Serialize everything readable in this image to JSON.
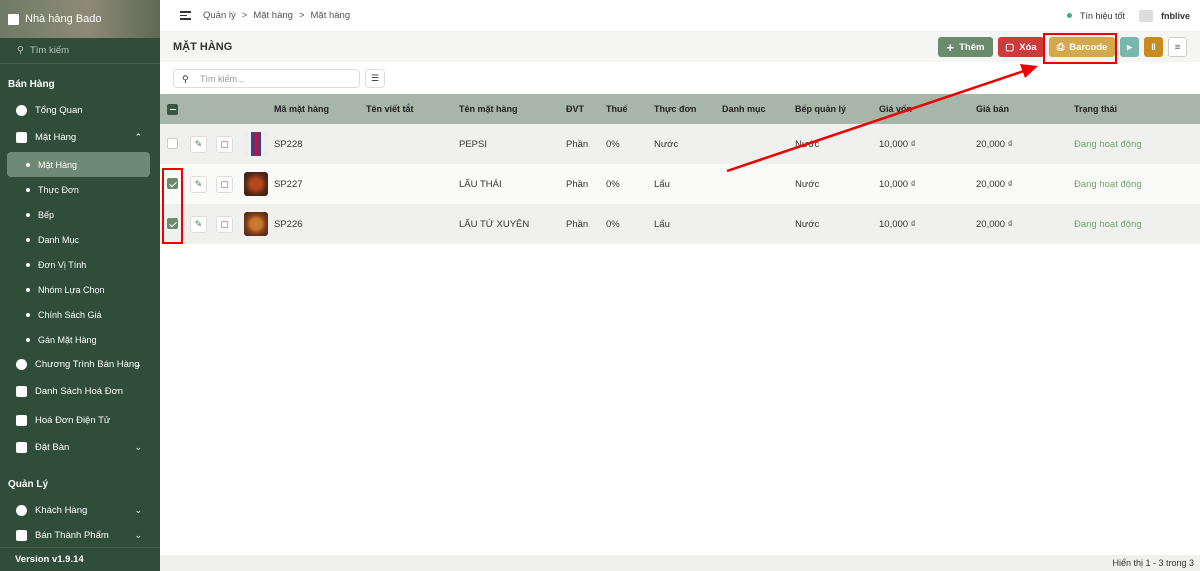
{
  "sidebar": {
    "brand": "Nhà hàng Bado",
    "search_placeholder": "Tìm kiếm",
    "section_sales": "Bán Hàng",
    "overview": "Tổng Quan",
    "items_group": "Mặt Hàng",
    "sub_items": [
      "Mặt Hàng",
      "Thực Đơn",
      "Bếp",
      "Danh Mục",
      "Đơn Vị Tính",
      "Nhóm Lựa Chọn",
      "Chính Sách Giá",
      "Gán Mặt Hàng"
    ],
    "sales_program": "Chương Trình Bán Hàng",
    "invoice_list": "Danh Sách Hoá Đơn",
    "e_invoice": "Hoá Đơn Điện Tử",
    "booking": "Đặt Bàn",
    "section_manage": "Quản Lý",
    "customers": "Khách Hàng",
    "semi_products": "Bán Thành Phẩm",
    "version": "Version v1.9.14"
  },
  "topbar": {
    "crumbs": [
      "Quản lý",
      ">",
      "Mặt hàng",
      ">",
      "Mặt hàng"
    ],
    "signal": "Tín hiệu tốt",
    "user": "fnblive"
  },
  "header": {
    "title": "MẶT HÀNG",
    "add_label": "Thêm",
    "delete_label": "Xóa",
    "barcode_label": "Barcode"
  },
  "search": {
    "placeholder": "Tìm kiếm..."
  },
  "table": {
    "columns": [
      "Mã mặt hàng",
      "Tên viết tắt",
      "Tên mặt hàng",
      "ĐVT",
      "Thuế",
      "Thực đơn",
      "Danh mục",
      "Bếp quản lý",
      "Giá vốn",
      "Giá bán",
      "Trạng thái"
    ],
    "rows": [
      {
        "code": "SP228",
        "short": "",
        "name": "PEPSI",
        "unit": "Phần",
        "tax": "0%",
        "menu": "Nước",
        "category": "",
        "kitchen": "Nước",
        "cost": "10,000 ₫",
        "price": "20,000 ₫",
        "status": "Đang hoạt động",
        "checked": false
      },
      {
        "code": "SP227",
        "short": "",
        "name": "LẨU THÁI",
        "unit": "Phần",
        "tax": "0%",
        "menu": "Lẩu",
        "category": "",
        "kitchen": "Nước",
        "cost": "10,000 ₫",
        "price": "20,000 ₫",
        "status": "Đang hoạt động",
        "checked": true
      },
      {
        "code": "SP226",
        "short": "",
        "name": "LẨU TỨ XUYÊN",
        "unit": "Phần",
        "tax": "0%",
        "menu": "Lẩu",
        "category": "",
        "kitchen": "Nước",
        "cost": "10,000 ₫",
        "price": "20,000 ₫",
        "status": "Đang hoạt động",
        "checked": true
      }
    ]
  },
  "footer": {
    "text": "Hiển thị 1 - 3 trong 3"
  }
}
